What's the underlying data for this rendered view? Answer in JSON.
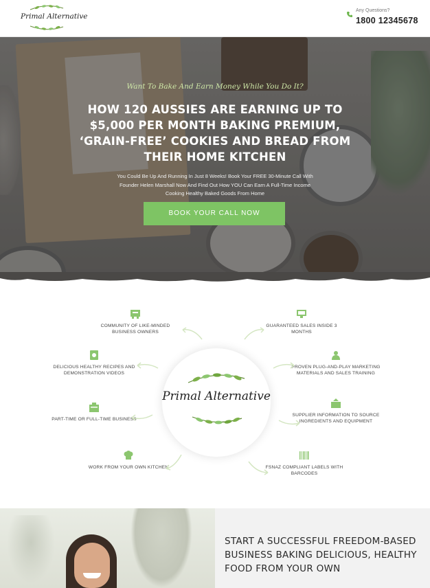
{
  "header": {
    "logo_text": "Primal Alternative",
    "contact_label": "Any Questions?",
    "phone": "1800 12345678"
  },
  "hero": {
    "tagline": "Want To Bake And Earn Money While You Do It?",
    "headline": "HOW 120 AUSSIES ARE EARNING UP TO $5,000 PER MONTH BAKING PREMIUM, ‘GRAIN-FREE’ COOKIES AND BREAD FROM THEIR HOME KITCHEN",
    "subtext": "You Could Be Up And Running In Just 8 Weeks! Book Your FREE 30-Minute Call With Founder Helen Marshall Now And Find Out How YOU Can Earn A Full-Time Income Cooking Healthy Baked Goods From Home",
    "cta_label": "BOOK YOUR CALL NOW"
  },
  "features": {
    "center_logo": "Primal Alternative",
    "items": [
      {
        "label": "COMMUNITY OF LIKE-MINDED BUSINESS OWNERS",
        "icon": "community-icon"
      },
      {
        "label": "GUARANTEED SALES INSIDE 3 MONTHS",
        "icon": "sales-icon"
      },
      {
        "label": "DELICIOUS HEALTHY RECIPES AND DEMONSTRATION VIDEOS",
        "icon": "recipe-icon"
      },
      {
        "label": "PROVEN PLUG-AND-PLAY MARKETING MATERIALS AND SALES TRAINING",
        "icon": "marketing-icon"
      },
      {
        "label": "PART-TIME OR FULL-TIME BUSINESS",
        "icon": "business-icon"
      },
      {
        "label": "SUPPLIER INFORMATION TO SOURCE INGREDIENTS AND EQUIPMENT",
        "icon": "supplier-icon"
      },
      {
        "label": "WORK FROM YOUR OWN KITCHEN",
        "icon": "chef-hat-icon"
      },
      {
        "label": "FSNAZ COMPLIANT LABELS WITH BARCODES",
        "icon": "barcode-icon"
      }
    ]
  },
  "bottom": {
    "title": "START A SUCCESSFUL FREEDOM-BASED BUSINESS BAKING DELICIOUS, HEALTHY FOOD FROM YOUR OWN"
  },
  "colors": {
    "accent": "#7ec464",
    "tagline": "#cfe8a8",
    "icon_green": "#8cc66f"
  }
}
